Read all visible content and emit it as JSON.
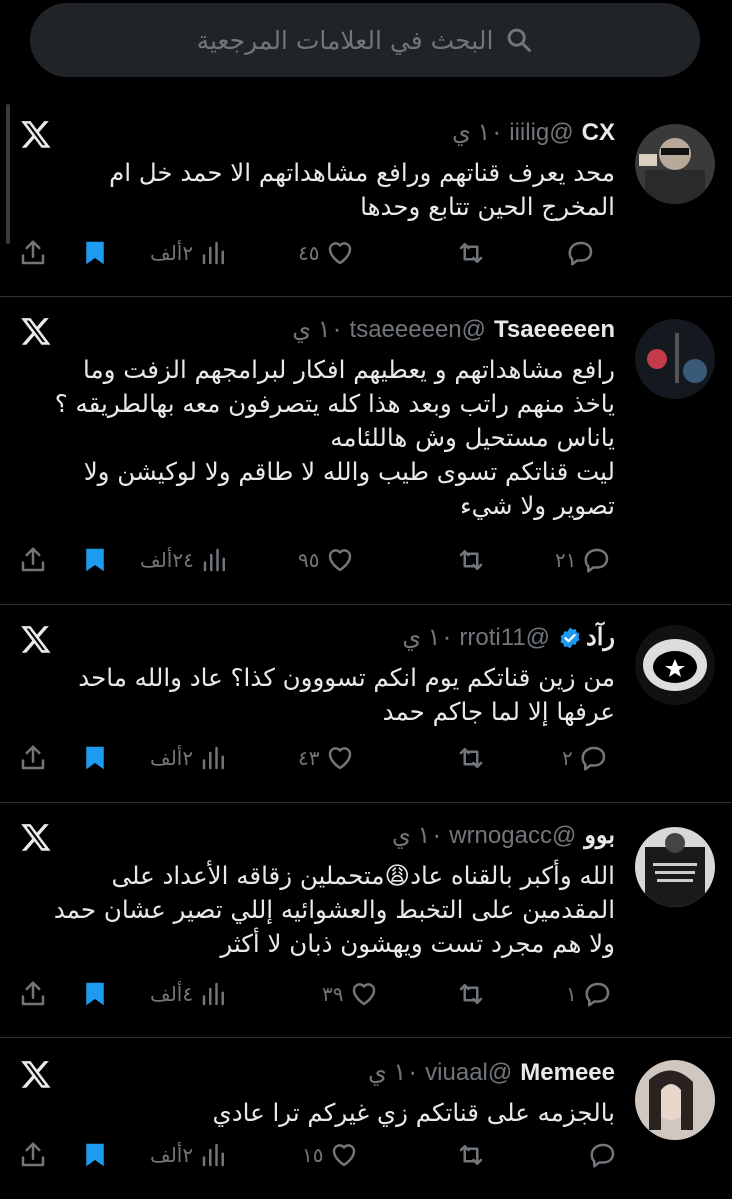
{
  "search": {
    "placeholder": "البحث في العلامات المرجعية"
  },
  "tweets": [
    {
      "name": "CX",
      "handle": "@iiilig",
      "time": "١٠ ي",
      "text": "محد يعرف قناتهم ورافع مشاهداتهم الا حمد خل ام\nالمخرج الحين تتابع وحدها",
      "replies": "",
      "likes": "٤٥",
      "views": "٢ألف"
    },
    {
      "name": "Tsaeeeeen",
      "handle": "@tsaeeeeen",
      "time": "١٠ ي",
      "text": "رافع مشاهداتهم و يعطيهم افكار لبرامجهم الزفت وما\nياخذ منهم راتب وبعد هذا كله يتصرفون معه بهالطريقه ؟\nياناس مستحيل وش هاللئامه\nليت قناتكم تسوى طيب والله لا طاقم ولا لوكيشن ولا\nتصوير ولا شيء",
      "replies": "٢١",
      "likes": "٩٥",
      "views": "٢٤ألف"
    },
    {
      "name": "رآد",
      "handle": "@rroti11",
      "time": "١٠ ي",
      "text": "من زين قناتكم  يوم انكم تسووون كذا؟ عاد والله ماحد\nعرفها إلا لما جاكم حمد",
      "replies": "٢",
      "likes": "٤٣",
      "views": "٢ألف"
    },
    {
      "name": "بوو",
      "handle": "@wrnogacc",
      "time": "١٠ ي",
      "text": "الله وأكبر بالقناه عاد😩متحملين زقاقه الأعداد على\nالمقدمين على التخبط والعشوائيه إللي تصير عشان حمد\nولا هم مجرد تست ويهشون ذبان لا أكثر",
      "replies": "١",
      "likes": "٣٩",
      "views": "٤ألف"
    },
    {
      "name": "Memeee",
      "handle": "@viuaal",
      "time": "١٠ ي",
      "text": "بالجزمه على قناتكم زي غيركم ترا عادي",
      "replies": "",
      "likes": "١٥",
      "views": "٢ألف"
    }
  ],
  "colors": {
    "accent": "#1d9bf0",
    "muted": "#71767b",
    "text": "#e7e9ea",
    "divider": "#2f3336"
  }
}
